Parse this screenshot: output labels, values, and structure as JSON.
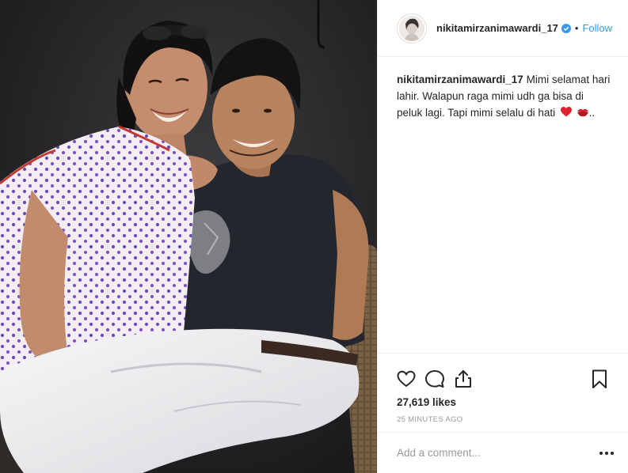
{
  "post": {
    "image_alt": "Photo of a smiling woman in a white polka-dot top sitting beside a smiling man in a dark t-shirt and white jeans",
    "author": {
      "username": "nikitamirzanimawardi_17",
      "verified": true,
      "follow_label": "Follow",
      "separator": "•"
    },
    "caption": {
      "username": "nikitamirzanimawardi_17",
      "text": "Mimi selamat hari lahir. Walapun raga mimi udh ga bisa di peluk lagi. Tapi mimi selalu di hati",
      "trailing": ".."
    },
    "actions": {
      "like_icon": "heart-icon",
      "comment_icon": "comment-icon",
      "share_icon": "share-icon",
      "save_icon": "bookmark-icon"
    },
    "likes_text": "27,619 likes",
    "timestamp": "25 MINUTES AGO",
    "comment_placeholder": "Add a comment...",
    "more_icon": "more-options-icon"
  },
  "colors": {
    "link_blue": "#3897f0",
    "text": "#262626",
    "muted": "#999999",
    "border": "#efefef",
    "emoji_red": "#e0212f"
  }
}
